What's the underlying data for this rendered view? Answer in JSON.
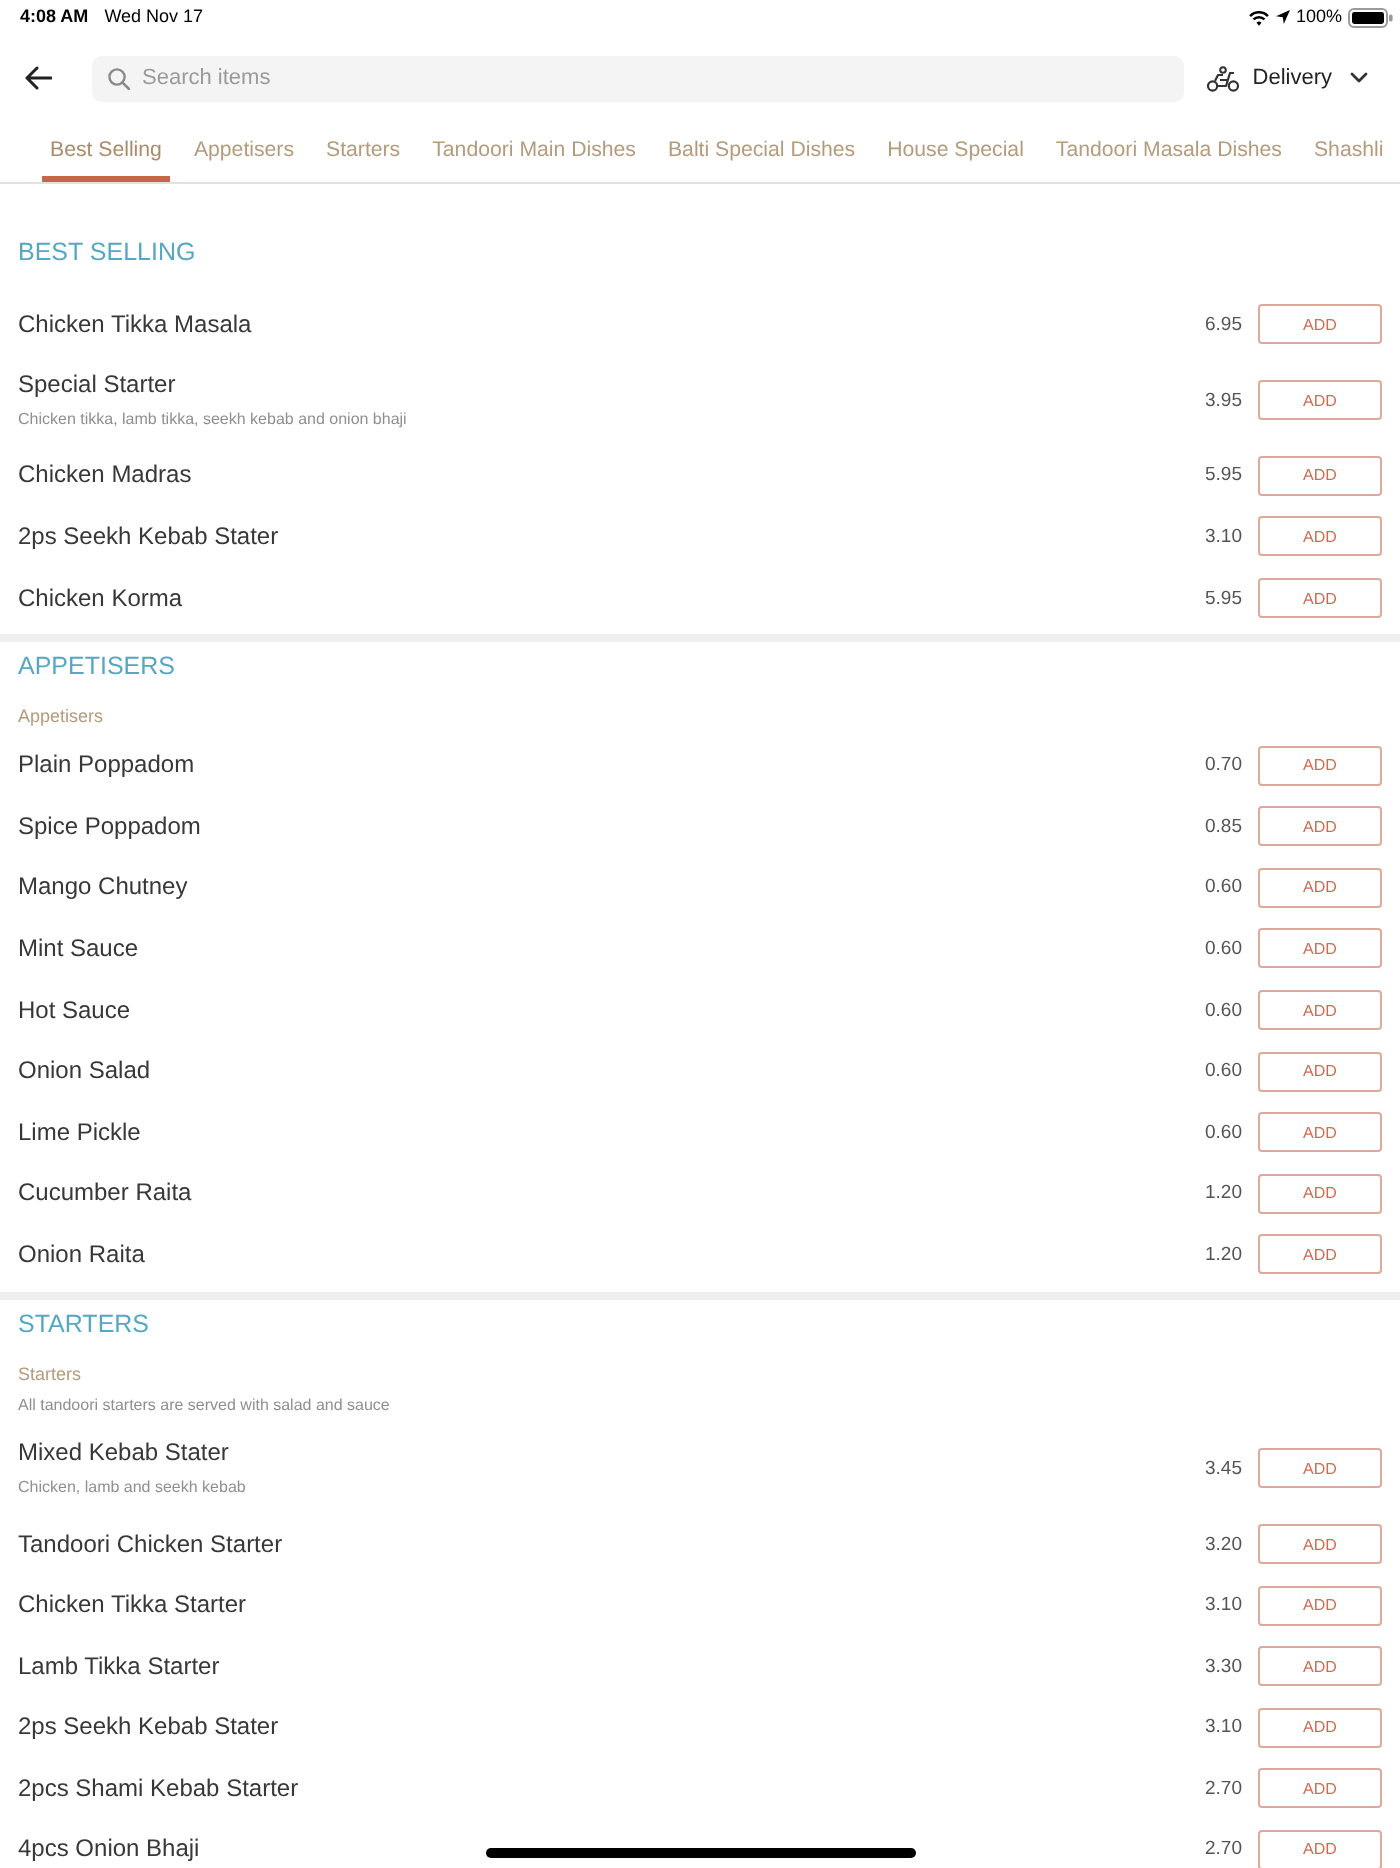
{
  "status_bar": {
    "time": "4:08 AM",
    "date": "Wed Nov 17",
    "battery": "100%"
  },
  "header": {
    "search": {
      "placeholder": "Search items"
    },
    "order_mode": {
      "label": "Delivery"
    }
  },
  "tabs": [
    {
      "label": "Best Selling",
      "selected": true
    },
    {
      "label": "Appetisers",
      "selected": false
    },
    {
      "label": "Starters",
      "selected": false
    },
    {
      "label": "Tandoori Main Dishes",
      "selected": false
    },
    {
      "label": "Balti Special Dishes",
      "selected": false
    },
    {
      "label": "House Special",
      "selected": false
    },
    {
      "label": "Tandoori Masala Dishes",
      "selected": false
    },
    {
      "label": "Shashli",
      "selected": false
    }
  ],
  "sections": [
    {
      "title": "BEST SELLING",
      "items": [
        {
          "name": "Chicken Tikka Masala",
          "price": "6.95",
          "button": "ADD"
        },
        {
          "name": "Special Starter",
          "description": "Chicken tikka, lamb tikka, seekh kebab and onion bhaji",
          "price": "3.95",
          "button": "ADD"
        },
        {
          "name": "Chicken Madras",
          "price": "5.95",
          "button": "ADD"
        },
        {
          "name": "2ps Seekh Kebab Stater",
          "price": "3.10",
          "button": "ADD"
        },
        {
          "name": "Chicken Korma",
          "price": "5.95",
          "button": "ADD"
        }
      ]
    },
    {
      "title": "APPETISERS",
      "subtitle": "Appetisers",
      "items": [
        {
          "name": "Plain Poppadom",
          "price": "0.70",
          "button": "ADD"
        },
        {
          "name": "Spice Poppadom",
          "price": "0.85",
          "button": "ADD"
        },
        {
          "name": "Mango Chutney",
          "price": "0.60",
          "button": "ADD"
        },
        {
          "name": "Mint Sauce",
          "price": "0.60",
          "button": "ADD"
        },
        {
          "name": "Hot Sauce",
          "price": "0.60",
          "button": "ADD"
        },
        {
          "name": "Onion Salad",
          "price": "0.60",
          "button": "ADD"
        },
        {
          "name": "Lime Pickle",
          "price": "0.60",
          "button": "ADD"
        },
        {
          "name": "Cucumber Raita",
          "price": "1.20",
          "button": "ADD"
        },
        {
          "name": "Onion Raita",
          "price": "1.20",
          "button": "ADD"
        }
      ]
    },
    {
      "title": "STARTERS",
      "subtitle": "Starters",
      "note": "All tandoori starters are served with salad and sauce",
      "items": [
        {
          "name": "Mixed Kebab Stater",
          "description": "Chicken, lamb and seekh kebab",
          "price": "3.45",
          "button": "ADD"
        },
        {
          "name": "Tandoori Chicken Starter",
          "price": "3.20",
          "button": "ADD"
        },
        {
          "name": "Chicken Tikka Starter",
          "price": "3.10",
          "button": "ADD"
        },
        {
          "name": "Lamb Tikka Starter",
          "price": "3.30",
          "button": "ADD"
        },
        {
          "name": "2ps Seekh Kebab Stater",
          "price": "3.10",
          "button": "ADD"
        },
        {
          "name": "2pcs Shami Kebab Starter",
          "price": "2.70",
          "button": "ADD"
        },
        {
          "name": "4pcs Onion Bhaji",
          "price": "2.70",
          "button": "ADD"
        }
      ]
    }
  ]
}
